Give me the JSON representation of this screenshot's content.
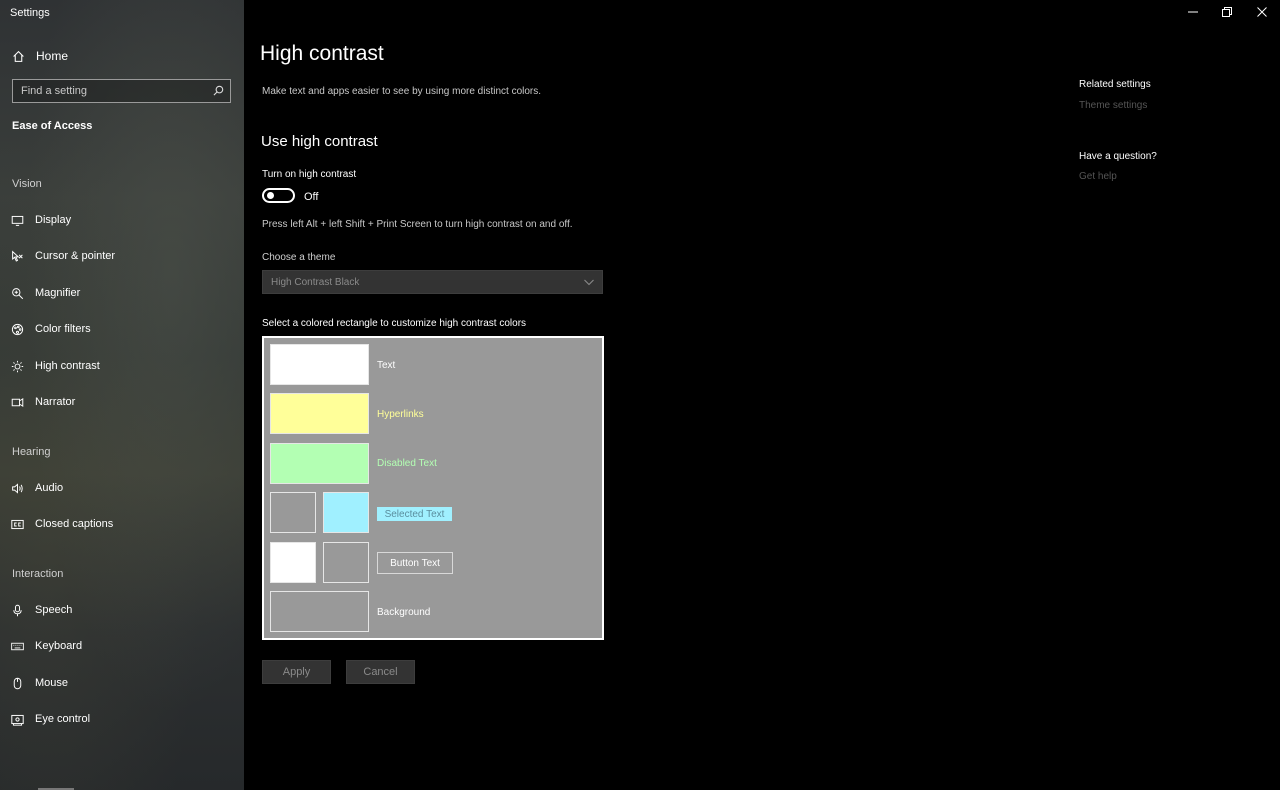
{
  "app": {
    "title": "Settings"
  },
  "window": {
    "minimize_icon": "minimize-icon",
    "restore_icon": "restore-icon",
    "close_icon": "close-icon"
  },
  "sidebar": {
    "home": "Home",
    "search_placeholder": "Find a setting",
    "section": "Ease of Access",
    "groups": {
      "vision": "Vision",
      "hearing": "Hearing",
      "interaction": "Interaction"
    },
    "items": [
      {
        "label": "Display",
        "icon": "display-icon"
      },
      {
        "label": "Cursor & pointer",
        "icon": "cursor-icon"
      },
      {
        "label": "Magnifier",
        "icon": "magnifier-icon"
      },
      {
        "label": "Color filters",
        "icon": "color-filters-icon"
      },
      {
        "label": "High contrast",
        "icon": "high-contrast-icon"
      },
      {
        "label": "Narrator",
        "icon": "narrator-icon"
      },
      {
        "label": "Audio",
        "icon": "audio-icon"
      },
      {
        "label": "Closed captions",
        "icon": "closed-captions-icon"
      },
      {
        "label": "Speech",
        "icon": "microphone-icon"
      },
      {
        "label": "Keyboard",
        "icon": "keyboard-icon"
      },
      {
        "label": "Mouse",
        "icon": "mouse-icon"
      },
      {
        "label": "Eye control",
        "icon": "eye-control-icon"
      }
    ]
  },
  "main": {
    "title": "High contrast",
    "description": "Make text and apps easier to see by using more distinct colors.",
    "use_heading": "Use high contrast",
    "toggle_label": "Turn on high contrast",
    "toggle_state": "Off",
    "toggle_on": false,
    "shortcut_hint": "Press left Alt + left Shift + Print Screen to turn high contrast on and off.",
    "theme_label": "Choose a theme",
    "theme_value": "High Contrast Black",
    "palette_label": "Select a colored rectangle to customize high contrast colors",
    "palette": {
      "text": {
        "label": "Text",
        "color": "#ffffff"
      },
      "hyperlinks": {
        "label": "Hyperlinks",
        "color": "#ffff99"
      },
      "disabled": {
        "label": "Disabled Text",
        "color": "#b3ffb3"
      },
      "selected": {
        "label": "Selected Text",
        "bg_color": "#999999",
        "color": "#a0f0ff"
      },
      "button": {
        "label": "Button Text",
        "fg_color": "#ffffff",
        "bg_color": "#999999"
      },
      "background": {
        "label": "Background",
        "color": "#999999"
      }
    },
    "apply": "Apply",
    "cancel": "Cancel"
  },
  "related": {
    "title": "Related settings",
    "theme_link": "Theme settings",
    "question_title": "Have a question?",
    "help_link": "Get help"
  }
}
